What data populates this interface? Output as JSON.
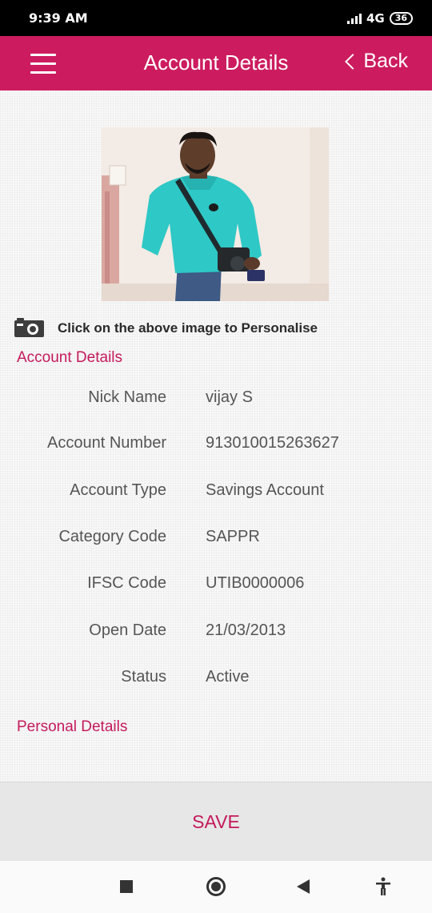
{
  "status_bar": {
    "time": "9:39 AM",
    "network": "4G",
    "battery": "36"
  },
  "header": {
    "title": "Account Details",
    "back_label": "Back",
    "menu_icon": "hamburger-menu-icon"
  },
  "profile": {
    "personalise_text": "Click on the above image to Personalise",
    "camera_icon": "camera-icon"
  },
  "sections": {
    "account_details_title": "Account Details",
    "personal_details_title": "Personal Details"
  },
  "account_details": [
    {
      "label": "Nick Name",
      "value": "vijay S"
    },
    {
      "label": "Account Number",
      "value": "913010015263627"
    },
    {
      "label": "Account Type",
      "value": "Savings Account"
    },
    {
      "label": "Category Code",
      "value": "SAPPR"
    },
    {
      "label": "IFSC Code",
      "value": "UTIB0000006"
    },
    {
      "label": "Open Date",
      "value": "21/03/2013"
    },
    {
      "label": "Status",
      "value": "Active"
    }
  ],
  "footer": {
    "save_label": "SAVE"
  },
  "colors": {
    "accent": "#cc1c5f",
    "section_title": "#c41a5b"
  }
}
